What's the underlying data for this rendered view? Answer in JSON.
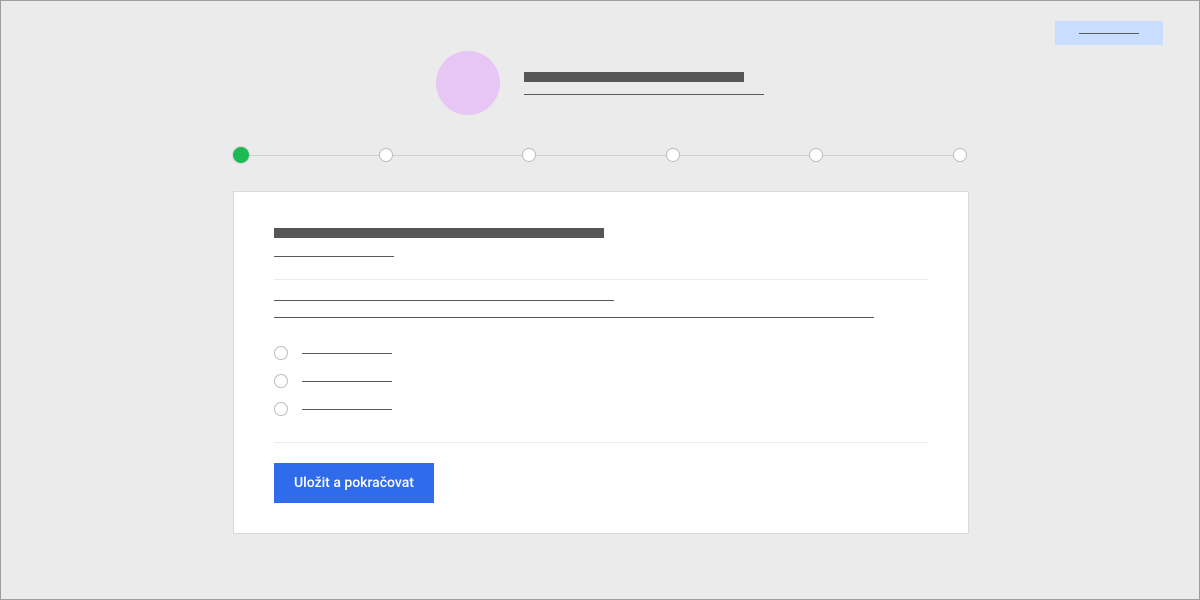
{
  "top_action": {
    "label": ""
  },
  "header": {
    "title": "",
    "subtitle": ""
  },
  "stepper": {
    "current_index": 0,
    "steps": [
      {
        "label": ""
      },
      {
        "label": ""
      },
      {
        "label": ""
      },
      {
        "label": ""
      },
      {
        "label": ""
      },
      {
        "label": ""
      }
    ]
  },
  "card": {
    "heading": "",
    "subheading": "",
    "description_line_1": "",
    "description_line_2": "",
    "options": [
      {
        "label": ""
      },
      {
        "label": ""
      },
      {
        "label": ""
      }
    ],
    "primary_button": "Uložit a pokračovat"
  },
  "colors": {
    "accent_green": "#1db954",
    "primary_blue": "#2f6bea",
    "highlight_blue": "#c9deff",
    "avatar_purple": "#e7c6f6"
  }
}
